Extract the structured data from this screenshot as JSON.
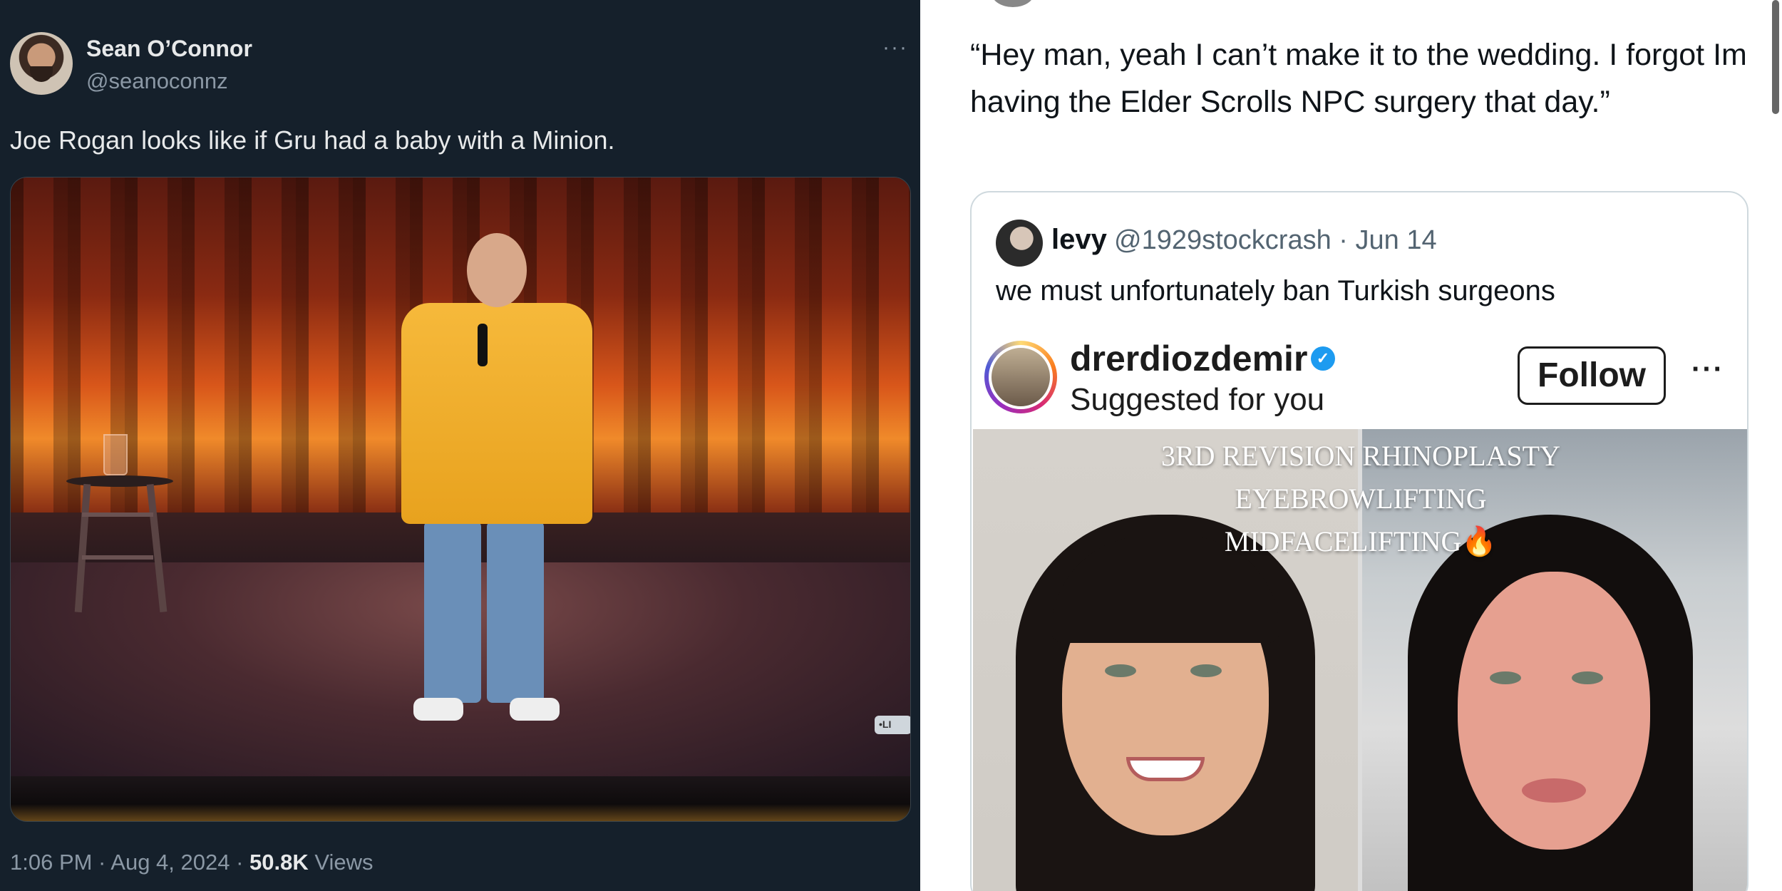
{
  "left_tweet": {
    "author_name": "Sean O’Connor",
    "author_handle": "@seanoconnz",
    "more": "···",
    "text": "Joe Rogan looks like if Gru had a baby with a Minion.",
    "photo_live_tag": "•LI",
    "meta": {
      "time": "1:06 PM · Aug 4, 2024 · ",
      "views_count": "50.8K",
      "views_label": " Views"
    }
  },
  "right_tweet": {
    "text": "“Hey man, yeah I can’t make it to the wedding. I forgot Im having the Elder Scrolls NPC surgery that day.”",
    "quote": {
      "name": "levy",
      "handle_date": "@1929stockcrash · Jun 14",
      "text": "we must unfortunately ban Turkish surgeons",
      "instagram": {
        "username": "drerdiozdemir",
        "verified_mark": "✓",
        "subtitle": "Suggested for you",
        "follow_label": "Follow",
        "more": "···",
        "overlay": [
          "3RD REVISION RHINOPLASTY",
          "EYEBROWLIFTING",
          "MIDFACELIFTING🔥"
        ]
      }
    }
  },
  "colors": {
    "dark_bg": "#15202b",
    "dark_text": "#e7e9ea",
    "dark_secondary": "#8b98a5",
    "light_bg": "#ffffff",
    "light_secondary": "#536471",
    "verified_blue": "#1d9bf0"
  },
  "icons": {
    "left_avatar": "profile-photo",
    "more": "more-horizontal-icon",
    "verified": "verified-badge-icon"
  }
}
